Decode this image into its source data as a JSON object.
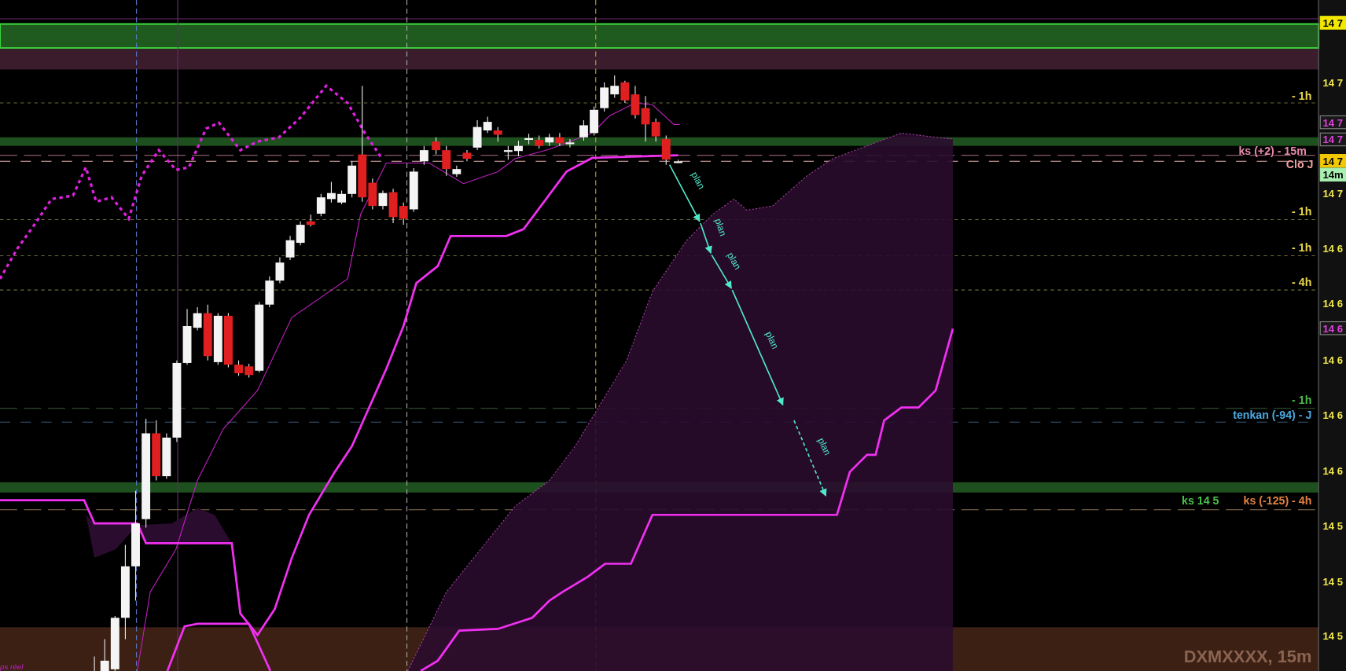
{
  "chart": {
    "symbol_label": "DXMXXXX, 15m",
    "corner_label": "ps réel",
    "level_labels": [
      {
        "text": "- 1h",
        "color": "#e8d84a"
      },
      {
        "text": "ks (+2) - 15m",
        "color": "#e58aa8"
      },
      {
        "text": "Clo J",
        "color": "#f0a0a0"
      },
      {
        "text": "- 1h",
        "color": "#e8d84a"
      },
      {
        "text": "- 1h",
        "color": "#e8d84a"
      },
      {
        "text": "- 4h",
        "color": "#e8d84a"
      },
      {
        "text": "- 1h",
        "color": "#4cb84c"
      },
      {
        "text": "tenkan (-94) - J",
        "color": "#4aa8e0"
      },
      {
        "text": "ks 14 5",
        "color": "#4cc04c"
      },
      {
        "text": "ks (-125) - 4h",
        "color": "#e08040"
      }
    ],
    "plan_labels": [
      "plan",
      "plan",
      "plan",
      "plan",
      "plan"
    ],
    "price_labels": [
      {
        "text": "14 7",
        "kind": "tag",
        "color": "#f2e800"
      },
      {
        "text": "14 7",
        "kind": "plain",
        "color": "#f0e84a"
      },
      {
        "text": "14 7",
        "kind": "tag",
        "color": "#e040e0"
      },
      {
        "text": "14 7",
        "kind": "tag",
        "color": "#e040e0"
      },
      {
        "text": "14 7",
        "kind": "tag",
        "color": "#f2c800"
      },
      {
        "text": "14m",
        "kind": "tag",
        "color": "#a8f0b0"
      },
      {
        "text": "14 7",
        "kind": "plain",
        "color": "#f0e84a"
      },
      {
        "text": "14 6",
        "kind": "plain",
        "color": "#f0e84a"
      },
      {
        "text": "14 6",
        "kind": "plain",
        "color": "#f0e84a"
      },
      {
        "text": "14 6",
        "kind": "tag",
        "color": "#e040e0"
      },
      {
        "text": "14 6",
        "kind": "plain",
        "color": "#f0e84a"
      },
      {
        "text": "14 6",
        "kind": "plain",
        "color": "#f0e84a"
      },
      {
        "text": "14 6",
        "kind": "plain",
        "color": "#f0e84a"
      },
      {
        "text": "14 5",
        "kind": "plain",
        "color": "#f0e84a"
      },
      {
        "text": "14 5",
        "kind": "plain",
        "color": "#f0e84a"
      },
      {
        "text": "14 5",
        "kind": "plain",
        "color": "#f0e84a"
      }
    ]
  }
}
